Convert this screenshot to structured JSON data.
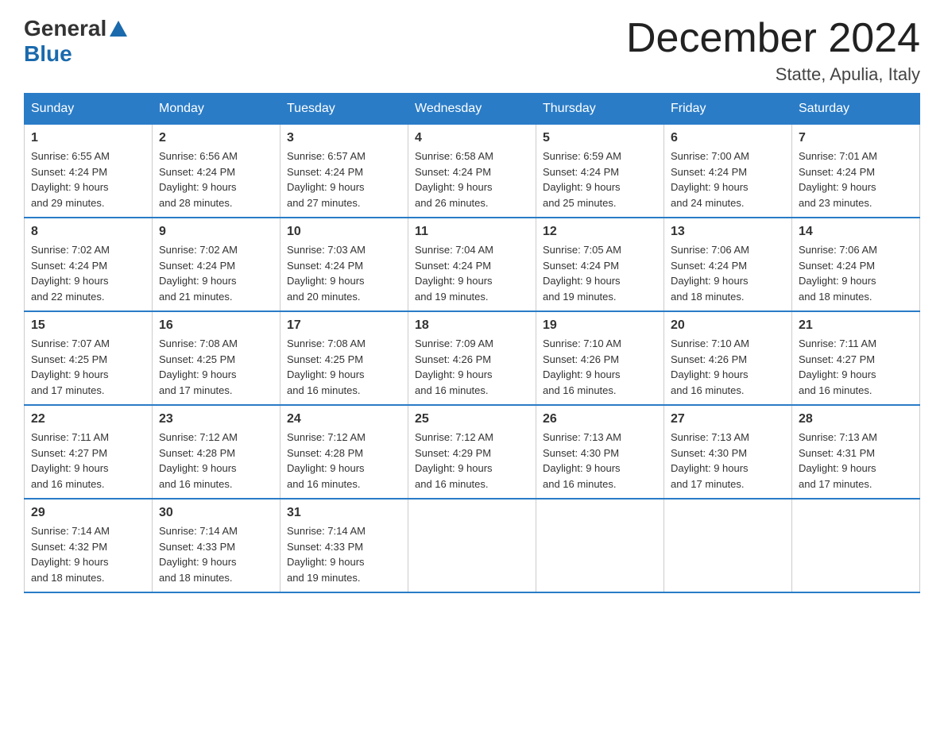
{
  "header": {
    "logo": {
      "line1": "General",
      "line2": "Blue"
    },
    "title": "December 2024",
    "location": "Statte, Apulia, Italy"
  },
  "weekdays": [
    "Sunday",
    "Monday",
    "Tuesday",
    "Wednesday",
    "Thursday",
    "Friday",
    "Saturday"
  ],
  "weeks": [
    [
      {
        "day": "1",
        "sunrise": "6:55 AM",
        "sunset": "4:24 PM",
        "daylight": "9 hours and 29 minutes."
      },
      {
        "day": "2",
        "sunrise": "6:56 AM",
        "sunset": "4:24 PM",
        "daylight": "9 hours and 28 minutes."
      },
      {
        "day": "3",
        "sunrise": "6:57 AM",
        "sunset": "4:24 PM",
        "daylight": "9 hours and 27 minutes."
      },
      {
        "day": "4",
        "sunrise": "6:58 AM",
        "sunset": "4:24 PM",
        "daylight": "9 hours and 26 minutes."
      },
      {
        "day": "5",
        "sunrise": "6:59 AM",
        "sunset": "4:24 PM",
        "daylight": "9 hours and 25 minutes."
      },
      {
        "day": "6",
        "sunrise": "7:00 AM",
        "sunset": "4:24 PM",
        "daylight": "9 hours and 24 minutes."
      },
      {
        "day": "7",
        "sunrise": "7:01 AM",
        "sunset": "4:24 PM",
        "daylight": "9 hours and 23 minutes."
      }
    ],
    [
      {
        "day": "8",
        "sunrise": "7:02 AM",
        "sunset": "4:24 PM",
        "daylight": "9 hours and 22 minutes."
      },
      {
        "day": "9",
        "sunrise": "7:02 AM",
        "sunset": "4:24 PM",
        "daylight": "9 hours and 21 minutes."
      },
      {
        "day": "10",
        "sunrise": "7:03 AM",
        "sunset": "4:24 PM",
        "daylight": "9 hours and 20 minutes."
      },
      {
        "day": "11",
        "sunrise": "7:04 AM",
        "sunset": "4:24 PM",
        "daylight": "9 hours and 19 minutes."
      },
      {
        "day": "12",
        "sunrise": "7:05 AM",
        "sunset": "4:24 PM",
        "daylight": "9 hours and 19 minutes."
      },
      {
        "day": "13",
        "sunrise": "7:06 AM",
        "sunset": "4:24 PM",
        "daylight": "9 hours and 18 minutes."
      },
      {
        "day": "14",
        "sunrise": "7:06 AM",
        "sunset": "4:24 PM",
        "daylight": "9 hours and 18 minutes."
      }
    ],
    [
      {
        "day": "15",
        "sunrise": "7:07 AM",
        "sunset": "4:25 PM",
        "daylight": "9 hours and 17 minutes."
      },
      {
        "day": "16",
        "sunrise": "7:08 AM",
        "sunset": "4:25 PM",
        "daylight": "9 hours and 17 minutes."
      },
      {
        "day": "17",
        "sunrise": "7:08 AM",
        "sunset": "4:25 PM",
        "daylight": "9 hours and 16 minutes."
      },
      {
        "day": "18",
        "sunrise": "7:09 AM",
        "sunset": "4:26 PM",
        "daylight": "9 hours and 16 minutes."
      },
      {
        "day": "19",
        "sunrise": "7:10 AM",
        "sunset": "4:26 PM",
        "daylight": "9 hours and 16 minutes."
      },
      {
        "day": "20",
        "sunrise": "7:10 AM",
        "sunset": "4:26 PM",
        "daylight": "9 hours and 16 minutes."
      },
      {
        "day": "21",
        "sunrise": "7:11 AM",
        "sunset": "4:27 PM",
        "daylight": "9 hours and 16 minutes."
      }
    ],
    [
      {
        "day": "22",
        "sunrise": "7:11 AM",
        "sunset": "4:27 PM",
        "daylight": "9 hours and 16 minutes."
      },
      {
        "day": "23",
        "sunrise": "7:12 AM",
        "sunset": "4:28 PM",
        "daylight": "9 hours and 16 minutes."
      },
      {
        "day": "24",
        "sunrise": "7:12 AM",
        "sunset": "4:28 PM",
        "daylight": "9 hours and 16 minutes."
      },
      {
        "day": "25",
        "sunrise": "7:12 AM",
        "sunset": "4:29 PM",
        "daylight": "9 hours and 16 minutes."
      },
      {
        "day": "26",
        "sunrise": "7:13 AM",
        "sunset": "4:30 PM",
        "daylight": "9 hours and 16 minutes."
      },
      {
        "day": "27",
        "sunrise": "7:13 AM",
        "sunset": "4:30 PM",
        "daylight": "9 hours and 17 minutes."
      },
      {
        "day": "28",
        "sunrise": "7:13 AM",
        "sunset": "4:31 PM",
        "daylight": "9 hours and 17 minutes."
      }
    ],
    [
      {
        "day": "29",
        "sunrise": "7:14 AM",
        "sunset": "4:32 PM",
        "daylight": "9 hours and 18 minutes."
      },
      {
        "day": "30",
        "sunrise": "7:14 AM",
        "sunset": "4:33 PM",
        "daylight": "9 hours and 18 minutes."
      },
      {
        "day": "31",
        "sunrise": "7:14 AM",
        "sunset": "4:33 PM",
        "daylight": "9 hours and 19 minutes."
      },
      null,
      null,
      null,
      null
    ]
  ],
  "labels": {
    "sunrise": "Sunrise:",
    "sunset": "Sunset:",
    "daylight": "Daylight:"
  }
}
